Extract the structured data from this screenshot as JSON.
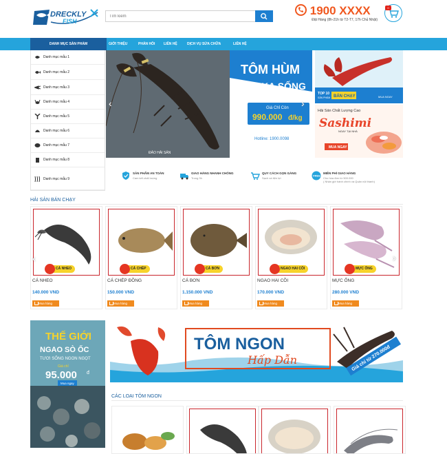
{
  "header": {
    "logo_text_top": "DRECKLY",
    "logo_text_bottom": "FISH",
    "search_placeholder": "Tìm kiếm",
    "hotline": "1900 XXXX",
    "hotline_hours": "Đặt Hàng (8h-21h từ T2-T7, 17h Chủ Nhật)",
    "cart_count": "0"
  },
  "nav": {
    "category_header": "DANH MỤC SẢN PHẨM",
    "items": [
      "GIỚI THIỆU",
      "PHẢN HỒI",
      "LIÊN HỆ",
      "DỊCH VỤ SỬA CHỮA",
      "LIÊN HỆ"
    ]
  },
  "sidebar": {
    "items": [
      {
        "label": "Danh mục mẫu 1",
        "icon": "fish-icon"
      },
      {
        "label": "Danh mục mẫu 2",
        "icon": "fish-icon"
      },
      {
        "label": "Danh mục mẫu 3",
        "icon": "squid-icon"
      },
      {
        "label": "Danh mục mẫu 4",
        "icon": "crab-icon"
      },
      {
        "label": "Danh mục mẫu 5",
        "icon": "lobster-icon"
      },
      {
        "label": "Danh mục mẫu 6",
        "icon": "shellfish-icon"
      },
      {
        "label": "Danh mục mẫu 7",
        "icon": "can-icon"
      },
      {
        "label": "Danh mục mẫu 8",
        "icon": "jar-icon"
      },
      {
        "label": "Danh mục mẫu 9",
        "icon": "seaweed-icon"
      }
    ]
  },
  "banner": {
    "title_line1": "TÔM HÙM",
    "title_line2": "ALASKA SỐNG",
    "price_label": "Giá Chỉ Còn",
    "price": "990.000",
    "price_unit": "đ/kg",
    "hotline": "Hotline: 1900.0098",
    "watermark": "ĐẢO HẢI SẢN"
  },
  "promo1": {
    "badge_top": "TOP 10",
    "badge_sub": "SẢN PHẨM",
    "badge_main": "BÁN CHẠY",
    "link": "MUA NGAY"
  },
  "promo2": {
    "title": "Hải Sản Chất Lượng Cao",
    "brand": "Sashimi",
    "sub": "NGAY TẠI NHÀ",
    "button": "MUA NGAY"
  },
  "features": [
    {
      "title": "SẢN PHẨM AN TOÀN",
      "sub": "Cam kết chất lượng",
      "icon": "shield-check-icon"
    },
    {
      "title": "GIAO HÀNG NHANH CHÓNG",
      "sub": "Trong 3h",
      "icon": "truck-icon"
    },
    {
      "title": "QUY CÁCH GỌN GÀNG",
      "sub": "Sạch và tiện lợi",
      "icon": "cart-icon"
    },
    {
      "title": "MIỄN PHÍ GIAO HÀNG",
      "sub": "Cho hóa đơn từ 500.000",
      "sub2": "( Nhận giờ hành chính và Quận nội thành)",
      "icon": "free-badge-icon"
    }
  ],
  "best_sellers": {
    "title": "HẢI SẢN BÁN CHẠY",
    "products": [
      {
        "label": "CÁ NHEO",
        "name": "CÁ NHEO",
        "price": "140.000 VND",
        "buy": "Mua hàng"
      },
      {
        "label": "CÁ CHÉP",
        "name": "CÁ CHÉP ĐỒNG",
        "price": "150.000 VND",
        "buy": "Mua hàng"
      },
      {
        "label": "CÁ BƠN",
        "name": "CÁ BƠN",
        "price": "1.150.000 VND",
        "buy": "Mua hàng"
      },
      {
        "label": "NGAO HAI CỒI",
        "name": "NGAO HAI CỒI",
        "price": "170.000 VND",
        "buy": "Mua hàng"
      },
      {
        "label": "MỰC ỐNG",
        "name": "MỰC ỐNG",
        "price": "280.000 VND",
        "buy": "Mua hàng"
      }
    ]
  },
  "side_banner": {
    "line1": "THẾ GIỚI",
    "line2": "NGAO SÒ ỐC",
    "line3": "TƯƠI SỐNG NGON NGỌT",
    "price_label": "Giá chỉ",
    "price": "95.000",
    "currency": "đ",
    "button": "Mua ngay"
  },
  "big_banner": {
    "title": "TÔM NGON",
    "subtitle": "Hấp Dẫn",
    "price_tag": "Giá chỉ từ 270.000đ"
  },
  "shrimp_section": {
    "title": "CÁC LOẠI TÔM NGON"
  }
}
